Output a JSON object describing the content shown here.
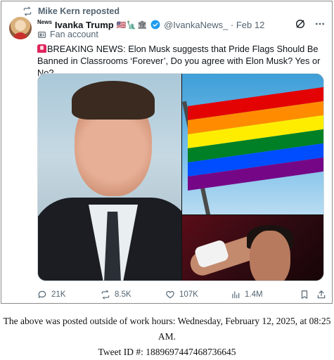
{
  "repost": {
    "text": "Mike Kern reposted"
  },
  "tweet": {
    "news_tag": "News",
    "display_name": "Ivanka Trump",
    "flags": "🇺🇸🗽🏛",
    "handle_date": "@IvankaNews_ · Feb 12",
    "fan_label": "Fan account",
    "body": "BREAKING NEWS: Elon Musk suggests that Pride Flags Should Be Banned in Classrooms ‘Forever’, Do you agree with Elon Musk? Yes or No?",
    "stats": {
      "replies": "21K",
      "reposts": "8.5K",
      "likes": "107K",
      "views": "1.4M"
    }
  },
  "colors": {
    "muted": "#536471",
    "verified": "#1d9bf0",
    "text": "#0f1419"
  },
  "flag_stripes": [
    "#e40303",
    "#ff8c00",
    "#ffed00",
    "#008026",
    "#004dff",
    "#750787"
  ],
  "footer": {
    "line1": "The above was posted outside of work hours: Wednesday, February 12, 2025, at 08:25 AM.",
    "line2": "Tweet ID #: 1889697447468736645"
  }
}
